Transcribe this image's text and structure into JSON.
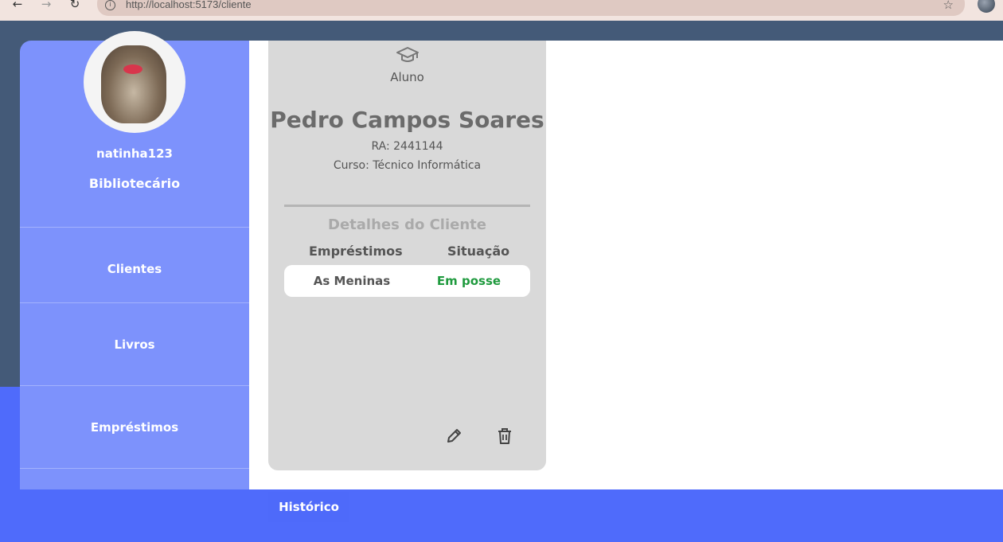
{
  "browser": {
    "url": "http://localhost:5173/cliente",
    "back": "←",
    "forward": "→",
    "reload": "↻",
    "star": "☆"
  },
  "sidebar": {
    "username": "natinha123",
    "role": "Bibliotecário",
    "items": [
      {
        "label": "Clientes"
      },
      {
        "label": "Livros"
      },
      {
        "label": "Empréstimos"
      }
    ]
  },
  "client": {
    "type": "Aluno",
    "name": "Pedro Campos Soares",
    "ra": "RA: 2441144",
    "curso": "Curso: Técnico Informática",
    "details_title": "Detalhes do Cliente",
    "columns": [
      "Empréstimos",
      "Situação"
    ],
    "loans": [
      {
        "book": "As Meninas",
        "status": "Em posse",
        "status_color": "#1f9a3e"
      }
    ]
  },
  "footer": {
    "historico_label": "Histórico"
  },
  "colors": {
    "sidebar": "#7d92fc",
    "accent": "#4f6bfb",
    "card": "#d9d9d9"
  },
  "icons": {
    "type_icon": "graduation-cap-icon",
    "edit_icon": "pencil-icon",
    "delete_icon": "trash-icon"
  }
}
